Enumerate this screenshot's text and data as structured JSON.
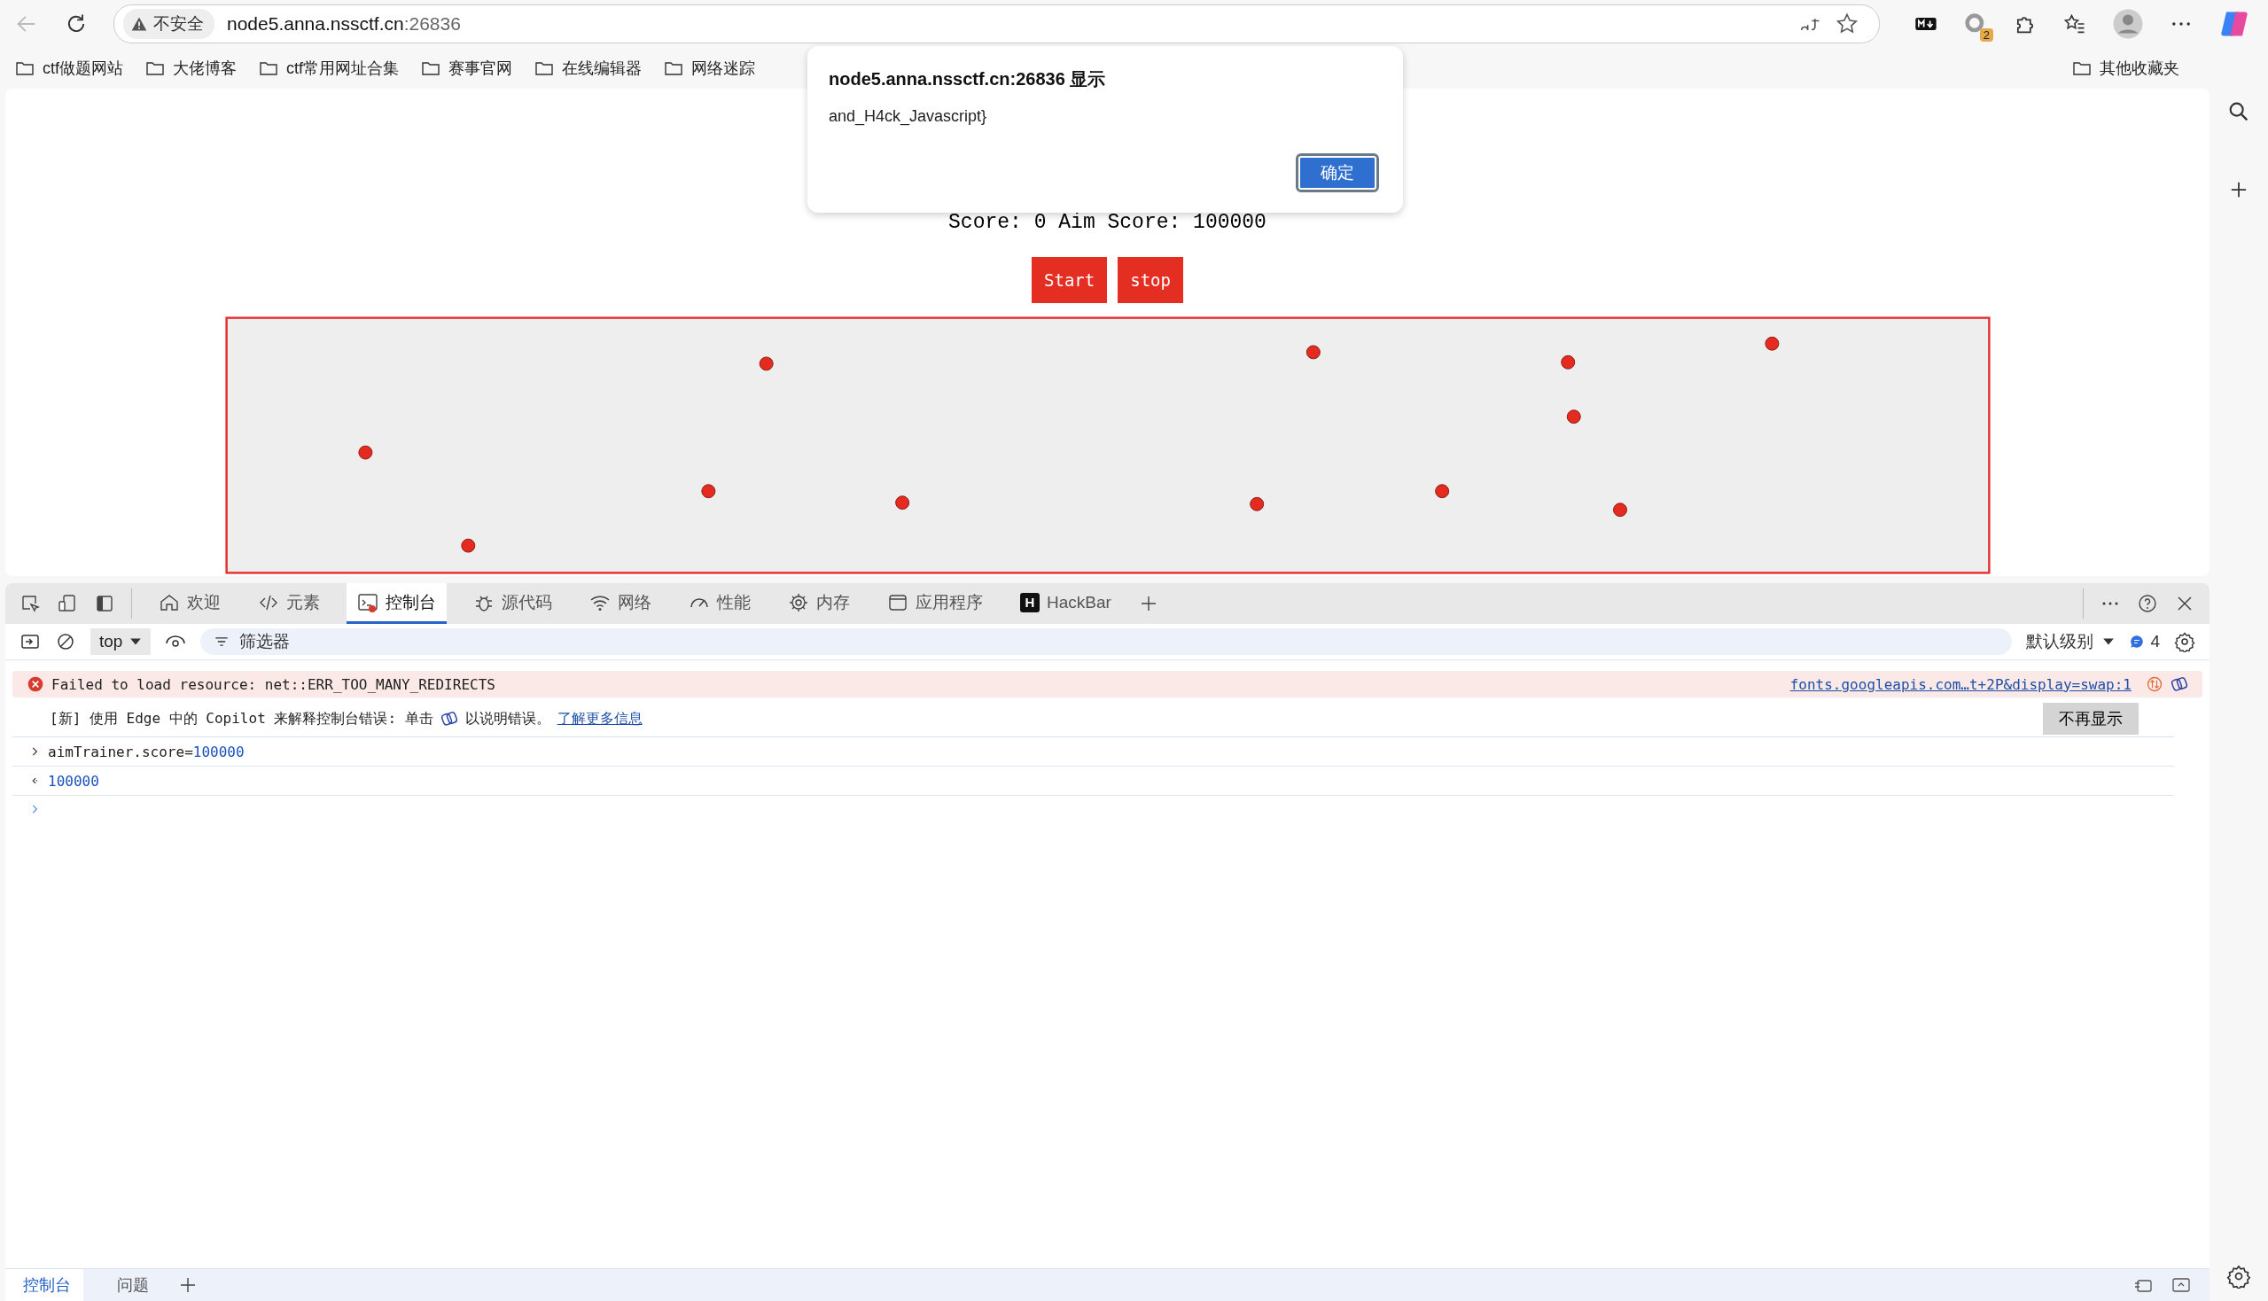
{
  "browser": {
    "security_label": "不安全",
    "host": "node5.anna.nssctf.cn",
    "port": ":26836",
    "extension_badge": "2",
    "bookmarks": [
      {
        "label": "ctf做题网站"
      },
      {
        "label": "大佬博客"
      },
      {
        "label": "ctf常用网址合集"
      },
      {
        "label": "赛事官网"
      },
      {
        "label": "在线编辑器"
      },
      {
        "label": "网络迷踪"
      }
    ],
    "other_bookmarks": "其他收藏夹"
  },
  "page": {
    "score_text": "Score: 0 Aim Score: 100000",
    "buttons": [
      "Start",
      "stop"
    ]
  },
  "dialog": {
    "title": "node5.anna.nssctf.cn:26836 显示",
    "message": "and_H4ck_Javascript}",
    "button": "确定"
  },
  "devtools": {
    "tabs": [
      {
        "kind": "home",
        "label": "欢迎",
        "selected": false
      },
      {
        "kind": "code",
        "label": "元素",
        "selected": false
      },
      {
        "kind": "console",
        "label": "控制台",
        "selected": true
      },
      {
        "kind": "bug",
        "label": "源代码",
        "selected": false
      },
      {
        "kind": "wifi",
        "label": "网络",
        "selected": false
      },
      {
        "kind": "gauge",
        "label": "性能",
        "selected": false
      },
      {
        "kind": "chip",
        "label": "内存",
        "selected": false
      },
      {
        "kind": "window",
        "label": "应用程序",
        "selected": false
      },
      {
        "kind": "hackbar",
        "icon_text": "H",
        "label": "HackBar",
        "selected": false
      }
    ],
    "context": "top",
    "filter_placeholder": "筛选器",
    "level_menu": "默认级别",
    "message_count": "4",
    "messages": [
      {
        "kind": "error",
        "text": "Failed to load resource: net::ERR_TOO_MANY_REDIRECTS",
        "source": "fonts.googleapis.com…t+2P&display=swap:1"
      },
      {
        "kind": "tip",
        "text": "[新] 使用 Edge 中的 Copilot 来解释控制台错误: 单击",
        "text_after": "以说明错误。",
        "link": "了解更多信息",
        "button": "不再显示"
      },
      {
        "kind": "input",
        "code": "aimTrainer.score=",
        "value": "100000"
      },
      {
        "kind": "output",
        "value": "100000"
      },
      {
        "kind": "prompt"
      }
    ],
    "drawer_tabs": [
      {
        "label": "控制台",
        "selected": true
      },
      {
        "label": "问题",
        "selected": false
      }
    ]
  }
}
